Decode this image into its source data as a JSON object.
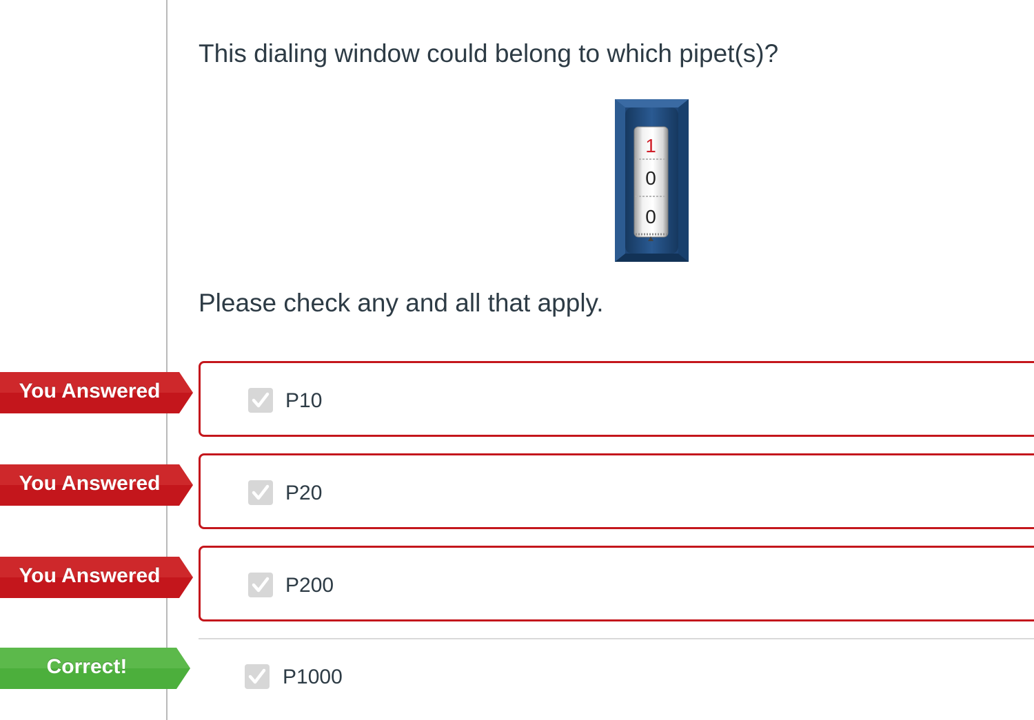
{
  "question": {
    "prompt": "This dialing window could belong to which pipet(s)?",
    "instruction": "Please check any and all that apply."
  },
  "dial": {
    "digits": [
      "1",
      "0",
      "0"
    ],
    "top_digit_color": "#d0202a",
    "frame_color": "#1f4a7c"
  },
  "answers": [
    {
      "label": "P10",
      "checked": true,
      "flag": "You Answered",
      "status": "incorrect"
    },
    {
      "label": "P20",
      "checked": true,
      "flag": "You Answered",
      "status": "incorrect"
    },
    {
      "label": "P200",
      "checked": true,
      "flag": "You Answered",
      "status": "incorrect"
    },
    {
      "label": "P1000",
      "checked": true,
      "flag": "Correct!",
      "status": "correct"
    }
  ],
  "colors": {
    "wrong_flag": "#c4161c",
    "correct_flag": "#4caf3c",
    "wrong_border": "#c4161c",
    "text": "#2d3b45"
  }
}
